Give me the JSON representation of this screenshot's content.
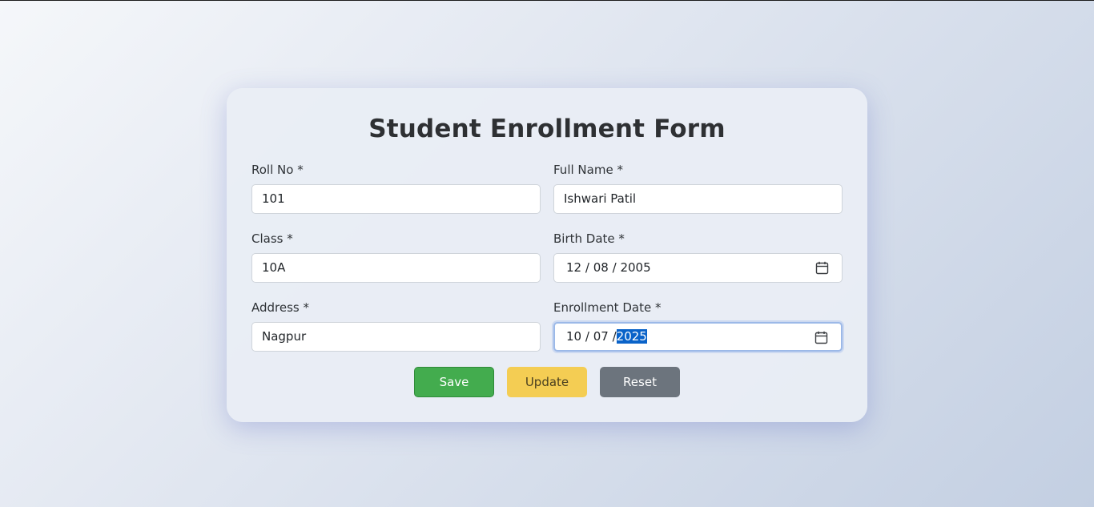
{
  "form": {
    "title": "Student Enrollment Form",
    "fields": {
      "roll_no": {
        "label": "Roll No *",
        "value": "101"
      },
      "full_name": {
        "label": "Full Name *",
        "value": "Ishwari Patil"
      },
      "class": {
        "label": "Class *",
        "value": "10A"
      },
      "birth_date": {
        "label": "Birth Date *",
        "day": "12",
        "month": "08",
        "year": "2005",
        "sep": "/"
      },
      "address": {
        "label": "Address *",
        "value": "Nagpur"
      },
      "enrollment_date": {
        "label": "Enrollment Date *",
        "day": "10",
        "month": "07",
        "year": "2025",
        "sep": "/"
      }
    },
    "buttons": {
      "save": "Save",
      "update": "Update",
      "reset": "Reset"
    }
  },
  "colors": {
    "save": "#43ac4e",
    "update": "#f4cd53",
    "reset": "#6c747d",
    "selection": "#0a63c9",
    "focus_ring": "#9cb9e8"
  },
  "icons": {
    "date_picker": "calendar-icon"
  }
}
